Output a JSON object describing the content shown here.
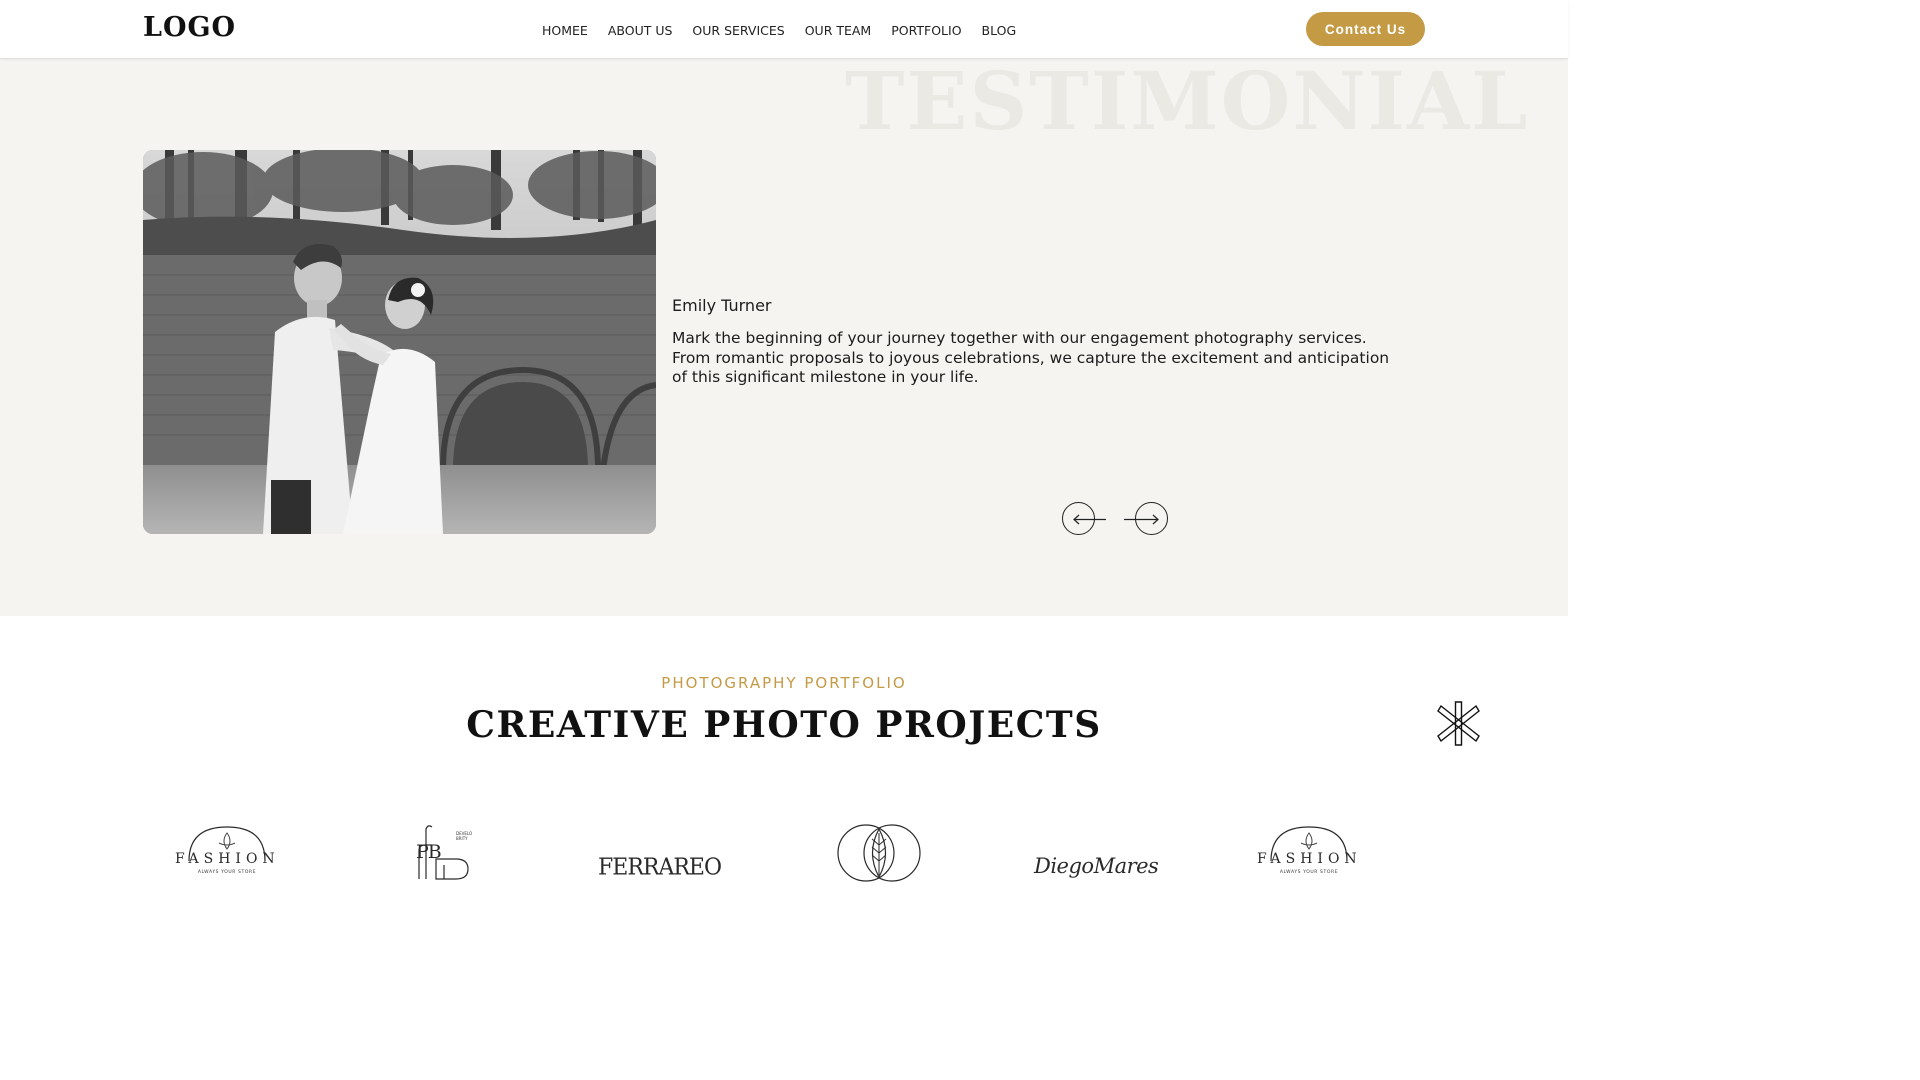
{
  "header": {
    "logo": "LOGO",
    "nav": [
      "HOMEE",
      "ABOUT US",
      "OUR SERVICES",
      "OUR TEAM",
      "PORTFOLIO",
      "BLOG"
    ],
    "contact_label": "Contact Us"
  },
  "testimonial": {
    "background_word": "TESTIMONIAL",
    "author": "Emily Turner",
    "quote": "Mark the beginning of your journey together with our engagement photography services. From romantic proposals to joyous celebrations, we capture the excitement and anticipation of this significant milestone in your life.",
    "prev_icon": "arrow-left-icon",
    "next_icon": "arrow-right-icon"
  },
  "portfolio": {
    "eyebrow": "PHOTOGRAPHY PORTFOLIO",
    "title": "CREATIVE PHOTO PROJECTS",
    "decor_icon": "asterisk-icon",
    "brands": {
      "fashion_1": {
        "name": "FASHION",
        "tagline": "ALWAYS YOUR STORE"
      },
      "pb": {
        "letters": "PB",
        "small": "DEVELO BRITY"
      },
      "ferrareo": {
        "name": "FERRAREO"
      },
      "leaf": {
        "icon": "leaf-circle-icon"
      },
      "diego": {
        "name": "DiegoMares"
      },
      "fashion_2": {
        "name": "FASHION",
        "tagline": "ALWAYS YOUR STORE"
      }
    }
  },
  "colors": {
    "accent": "#c49a45",
    "section_bg": "#f5f4f0",
    "text": "#1a1a1a"
  }
}
